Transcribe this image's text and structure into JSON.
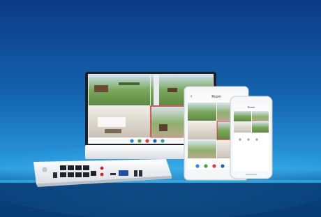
{
  "scene": {
    "subject": "nvr-security-system-product-shot",
    "colors": {
      "background_top": "#0a3f8c",
      "background_mid": "#1b7fc6",
      "background_glow": "#2fb3f0",
      "floor": "#0a4d8c",
      "device_body": "#f2f4f6",
      "screen_highlight": "#e2232b"
    }
  },
  "monitor": {
    "app_icons": [
      "monitor-app-icon-1",
      "monitor-app-icon-2",
      "monitor-app-icon-3",
      "monitor-app-icon-4",
      "monitor-app-icon-5"
    ]
  },
  "tablet": {
    "header_title": "Room",
    "back_glyph": "‹"
  },
  "phone": {
    "header_title": "Room"
  },
  "nvr": {
    "ethernet_port_count": 8
  }
}
